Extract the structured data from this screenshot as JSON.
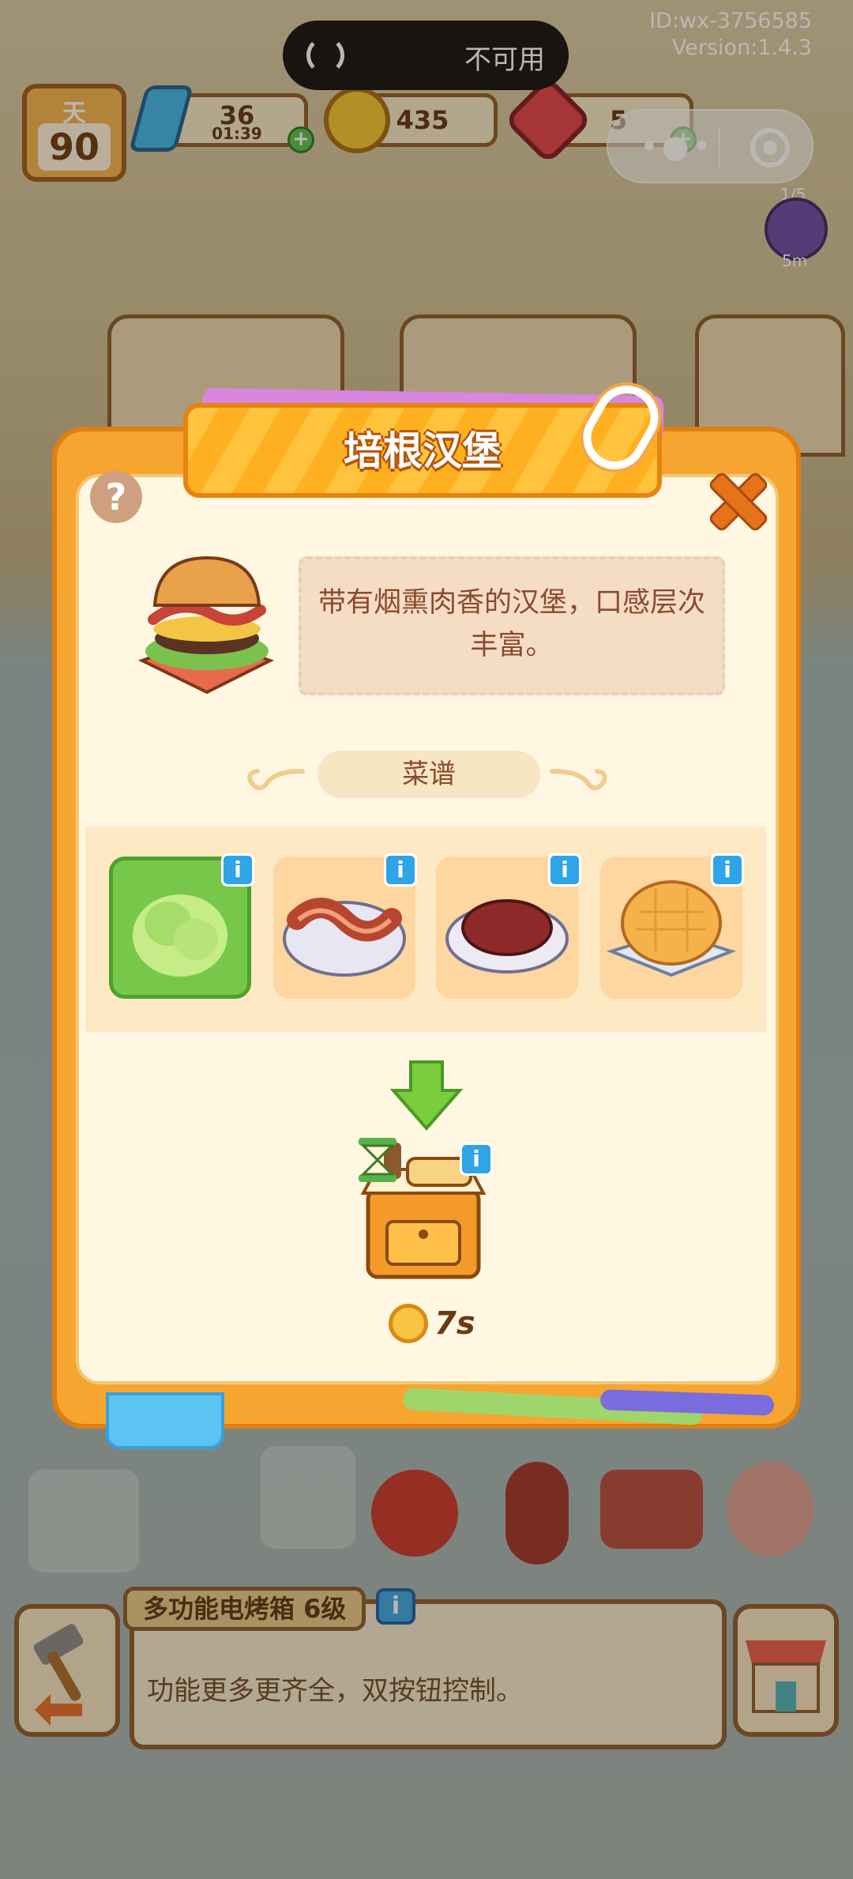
{
  "system": {
    "capsule_status": "不可用",
    "id_line": "ID:wx-3756585",
    "version_line": "Version:1.4.3"
  },
  "hud": {
    "day_label": "天",
    "day_number": "90",
    "energy": "36",
    "energy_timer": "01:39",
    "coins": "435",
    "gems": "5",
    "bonus_progress": "1/5",
    "bonus_timer": "5m"
  },
  "recipe_popup": {
    "title": "培根汉堡",
    "help_symbol": "?",
    "description": "带有烟熏肉香的汉堡，口感层次丰富。",
    "section_label": "菜谱",
    "ingredients": [
      {
        "name": "lettuce",
        "selected": true
      },
      {
        "name": "bacon",
        "selected": false
      },
      {
        "name": "beef-patty",
        "selected": false
      },
      {
        "name": "bun",
        "selected": false
      }
    ],
    "info_badge": "i",
    "cook_time": "7s"
  },
  "bottom_info": {
    "appliance_name": "多功能电烤箱 6级",
    "appliance_desc": "功能更多更齐全，双按钮控制。"
  },
  "colors": {
    "popup_frame": "#f6a531",
    "popup_inner": "#fff7e2",
    "title_ribbon": "#ffc33d",
    "selected_card": "#77c84a",
    "card": "#fdd6a0",
    "info_badge": "#2fa4e7"
  }
}
